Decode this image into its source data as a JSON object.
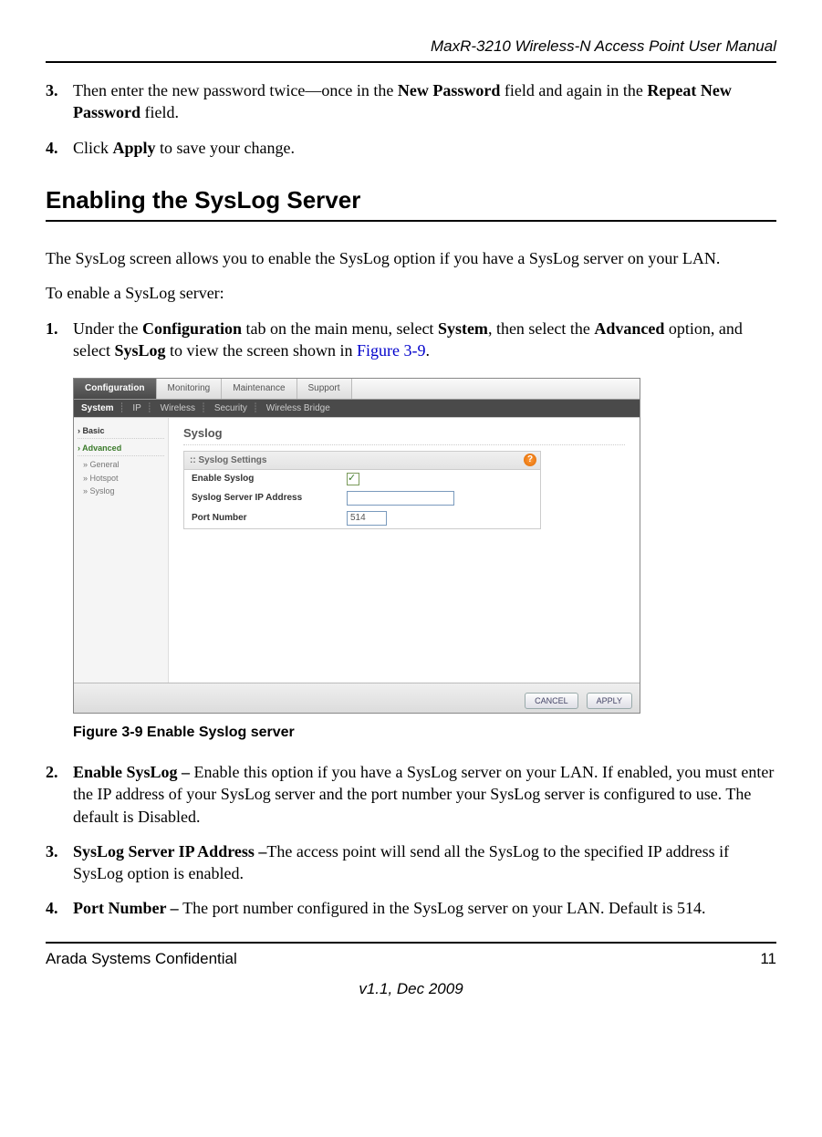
{
  "header": {
    "title": "MaxR-3210 Wireless-N Access Point User Manual"
  },
  "step3": {
    "num": "3.",
    "t1": "Then enter the new password twice—once in the ",
    "b1": "New Password",
    "t2": " field and again in the ",
    "b2": "Repeat New Password",
    "t3": " field."
  },
  "step4": {
    "num": "4.",
    "t1": "Click ",
    "b1": "Apply",
    "t2": " to save your change."
  },
  "section_heading": "Enabling the SysLog Server",
  "para1": "The SysLog screen allows you to enable the SysLog option if you have a SysLog server on your LAN.",
  "para2": "To enable a SysLog server:",
  "step1": {
    "num": "1.",
    "t1": "Under the ",
    "b1": "Configuration",
    "t2": " tab on the main menu, select ",
    "b2": "System",
    "t3": ", then select the ",
    "b3": "Advanced",
    "t4": " option, and select ",
    "b4": "SysLog",
    "t5": " to view the screen shown in ",
    "link": "Figure 3-9",
    "t6": "."
  },
  "screenshot": {
    "tabs": [
      "Configuration",
      "Monitoring",
      "Maintenance",
      "Support"
    ],
    "subnav": [
      "System",
      "IP",
      "Wireless",
      "Security",
      "Wireless Bridge"
    ],
    "sidebar": {
      "basic": "Basic",
      "advanced": "Advanced",
      "items": [
        "General",
        "Hotspot",
        "Syslog"
      ]
    },
    "content_title": "Syslog",
    "settings_title": "Syslog Settings",
    "fields": {
      "enable_label": "Enable Syslog",
      "ip_label": "Syslog Server IP Address",
      "ip_value": "",
      "port_label": "Port Number",
      "port_value": "514"
    },
    "buttons": {
      "cancel": "CANCEL",
      "apply": "APPLY"
    }
  },
  "figure_caption": "Figure 3-9  Enable Syslog server",
  "step2b": {
    "num": "2.",
    "b1": "Enable SysLog – ",
    "t1": "Enable this option if you have a SysLog server on your LAN. If enabled, you must enter the IP address of your SysLog server and the port number your SysLog server is configured to use. The default is Disabled."
  },
  "step3b": {
    "num": "3.",
    "b1": "SysLog Server IP Address –",
    "t1": "The access point will send all the SysLog to the specified IP address if SysLog option is enabled."
  },
  "step4b": {
    "num": "4.",
    "b1": "Port Number – ",
    "t1": "The port number configured in the SysLog server on your LAN. Default is 514."
  },
  "footer": {
    "left": "Arada Systems Confidential",
    "right": "11",
    "version": "v1.1, Dec 2009"
  }
}
